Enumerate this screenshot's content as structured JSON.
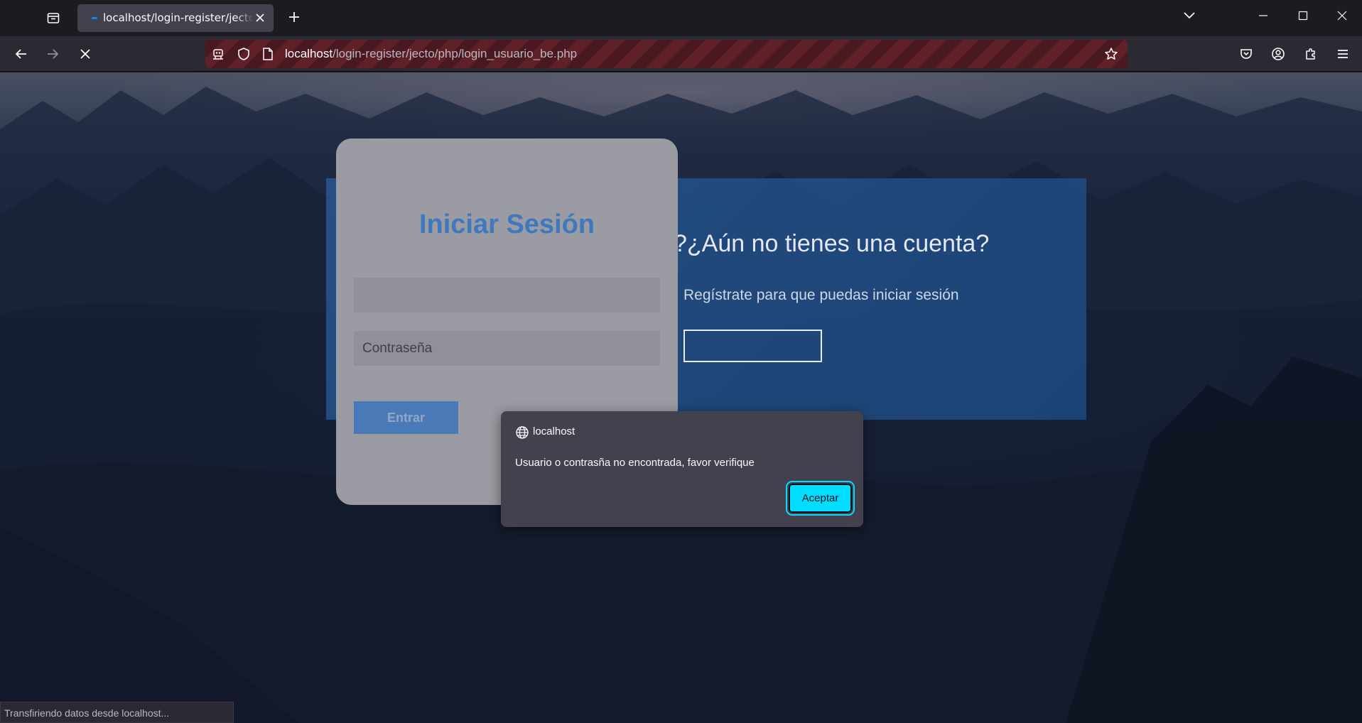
{
  "browser": {
    "tab": {
      "title": "localhost/login-register/jecto/p"
    },
    "url": {
      "host": "localhost",
      "path": "/login-register/jecto/php/login_usuario_be.php"
    },
    "icons": {
      "tab_list": "tab-list-icon",
      "tab_close": "close-icon",
      "new_tab": "plus-icon",
      "list_all_tabs": "chevron-down-icon",
      "minimize": "minimize-icon",
      "maximize": "maximize-icon",
      "close_window": "close-icon",
      "back": "arrow-left-icon",
      "forward": "arrow-right-icon",
      "stop": "stop-icon",
      "remote": "robot-icon",
      "tracking": "shield-icon",
      "page": "page-icon",
      "bookmark": "star-icon",
      "pocket": "pocket-icon",
      "account": "account-icon",
      "extensions": "puzzle-icon",
      "menu": "hamburger-menu-icon"
    },
    "status": "Transfiriendo datos desde localhost..."
  },
  "page": {
    "login": {
      "title": "Iniciar Sesión",
      "user_placeholder": "",
      "password_placeholder": "Contraseña",
      "submit_label": "Entrar"
    },
    "register_panel": {
      "title": "?¿Aún no tienes una cuenta?",
      "subtitle": "Regístrate para que puedas iniciar sesión",
      "button_label": ""
    }
  },
  "dialog": {
    "origin": "localhost",
    "message": "Usuario o contrasña no encontrada, favor verifique",
    "ok_label": "Aceptar"
  },
  "colors": {
    "accent": "#00ddff",
    "login_title": "#3f79bd",
    "tab_loading": "#0a84ff"
  }
}
